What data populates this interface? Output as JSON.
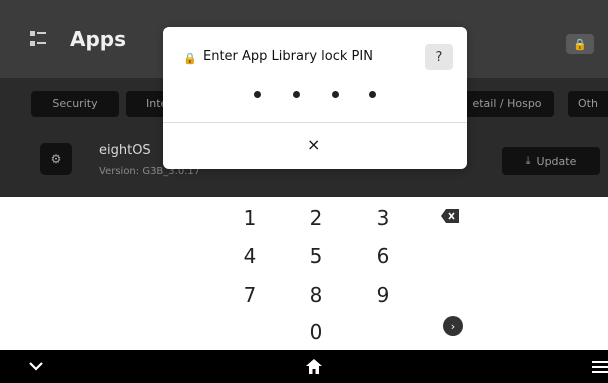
{
  "header": {
    "title": "Apps",
    "apps_icon": "list-icon",
    "lock_icon": "lock-icon"
  },
  "categories": [
    {
      "label": "Security"
    },
    {
      "label": "Inte"
    },
    {
      "label": "etail / Hospo"
    },
    {
      "label": "Oth"
    }
  ],
  "app": {
    "name": "eightOS",
    "version": "Version: G3B_3.0.17",
    "update_label": "Update",
    "icon": "gears-icon"
  },
  "dialog": {
    "title": "Enter App Library lock PIN",
    "help_label": "?",
    "pin_length": 4,
    "close_label": "×"
  },
  "keypad": {
    "rows": [
      [
        "1",
        "2",
        "3"
      ],
      [
        "4",
        "5",
        "6"
      ],
      [
        "7",
        "8",
        "9"
      ],
      [
        "",
        "0",
        ""
      ]
    ],
    "backspace_icon": "backspace-icon",
    "enter_icon": "enter-arrow-icon"
  },
  "navbar": {
    "left_icon": "chevron-down-icon",
    "center_icon": "home-icon",
    "right_icon": "menu-icon"
  }
}
